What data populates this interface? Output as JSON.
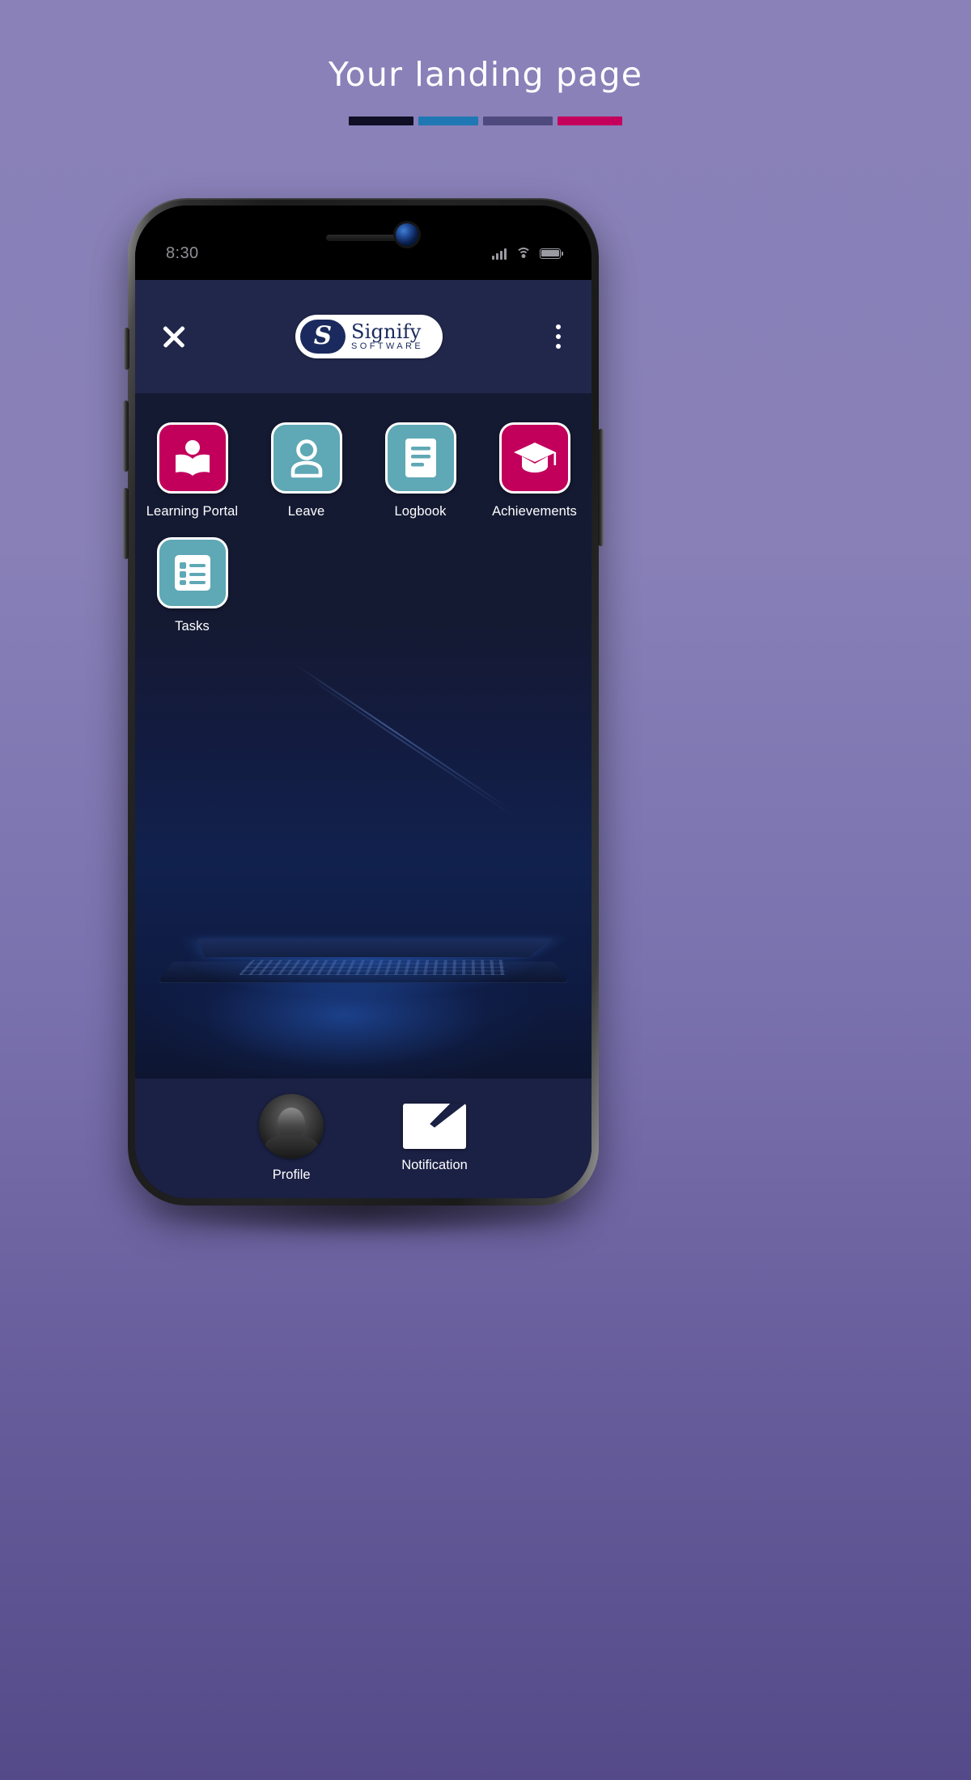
{
  "page": {
    "title": "Your landing page",
    "rule_colors": [
      "#100f26",
      "#1f78b4",
      "#4e4a7d",
      "#c4005c"
    ],
    "background_color": "#8981b8"
  },
  "phone": {
    "status_bar": {
      "time": "8:30",
      "signal_icon": "cellular-bars-icon",
      "wifi_icon": "wifi-icon",
      "battery_icon": "battery-full-icon"
    }
  },
  "app": {
    "header": {
      "close_label": "close-icon",
      "logo": {
        "mark": "S",
        "name": "Signify",
        "tagline": "SOFTWARE"
      },
      "menu_label": "overflow-menu-icon",
      "background_color": "#21274b"
    },
    "tiles": [
      {
        "label": "Learning Portal",
        "icon": "open-book-person-icon",
        "color": "#c2005c"
      },
      {
        "label": "Leave",
        "icon": "person-outline-icon",
        "color": "#5fa8b5"
      },
      {
        "label": "Logbook",
        "icon": "document-lines-icon",
        "color": "#5fa8b5"
      },
      {
        "label": "Achievements",
        "icon": "graduation-cap-icon",
        "color": "#c2005c"
      },
      {
        "label": "Tasks",
        "icon": "checklist-icon",
        "color": "#5fa8b5"
      }
    ],
    "footer": {
      "items": [
        {
          "label": "Profile",
          "icon": "user-avatar-photo"
        },
        {
          "label": "Notification",
          "icon": "envelope-icon"
        }
      ],
      "background_color": "#1b2144"
    }
  }
}
